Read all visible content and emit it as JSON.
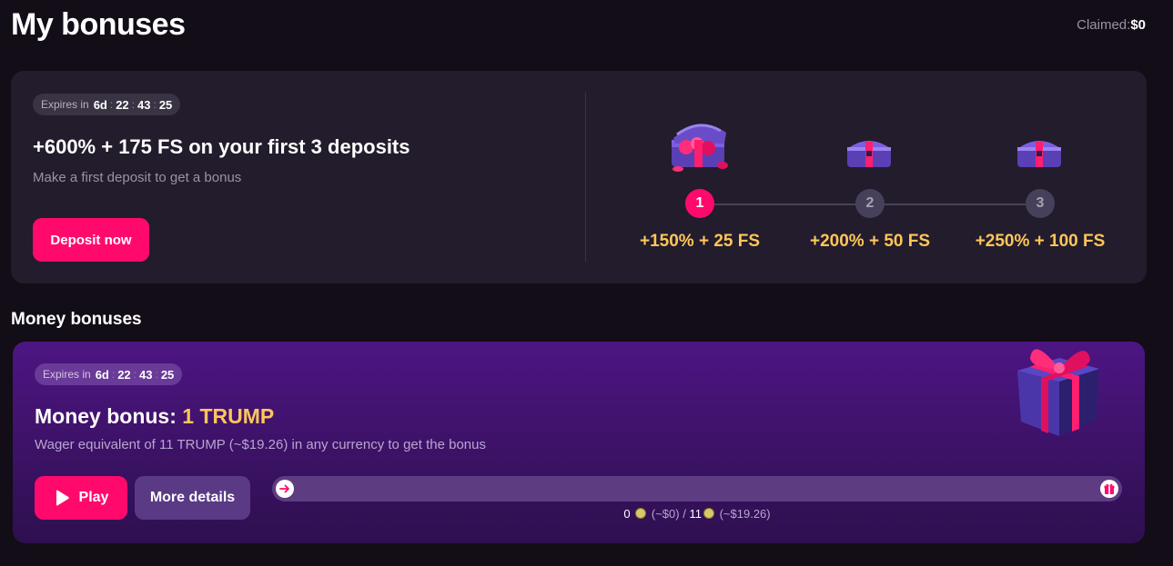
{
  "page": {
    "title": "My bonuses"
  },
  "claimed": {
    "label": "Claimed:",
    "value": "$0"
  },
  "deposit_offer": {
    "timer": {
      "label": "Expires in",
      "days": "6d",
      "hours": "22",
      "minutes": "43",
      "seconds": "25"
    },
    "title": "+600% + 175 FS on your first 3 deposits",
    "subtitle": "Make a first deposit to get a bonus",
    "cta_label": "Deposit now",
    "steps": [
      {
        "number": "1",
        "reward": "+150% + 25 FS",
        "active": true,
        "icon": "treasure-chest-open-icon"
      },
      {
        "number": "2",
        "reward": "+200% + 50 FS",
        "active": false,
        "icon": "treasure-chest-icon"
      },
      {
        "number": "3",
        "reward": "+250% + 100 FS",
        "active": false,
        "icon": "treasure-chest-icon"
      }
    ]
  },
  "money_bonuses": {
    "section_title": "Money bonuses",
    "card": {
      "timer": {
        "label": "Expires in",
        "days": "6d",
        "hours": "22",
        "minutes": "43",
        "seconds": "25"
      },
      "title_prefix": "Money bonus:",
      "title_amount": "1 TRUMP",
      "subtitle": "Wager equivalent of 11 TRUMP (~$19.26) in any currency to get the bonus",
      "play_label": "Play",
      "details_label": "More details",
      "progress": {
        "fraction": 0,
        "current": "0",
        "current_usd": "(~$0)",
        "separator": "/",
        "target": "11",
        "target_usd": "(~$19.26)"
      },
      "icons": [
        "play-icon",
        "arrow-right-icon",
        "gift-icon",
        "coin-icon",
        "gift-box-illustration"
      ]
    }
  },
  "colors": {
    "accent": "#ff0a6c",
    "reward": "#ffc65a",
    "background": "#120d17",
    "card": "#221c2c",
    "bonus_card": "#4d1583"
  }
}
